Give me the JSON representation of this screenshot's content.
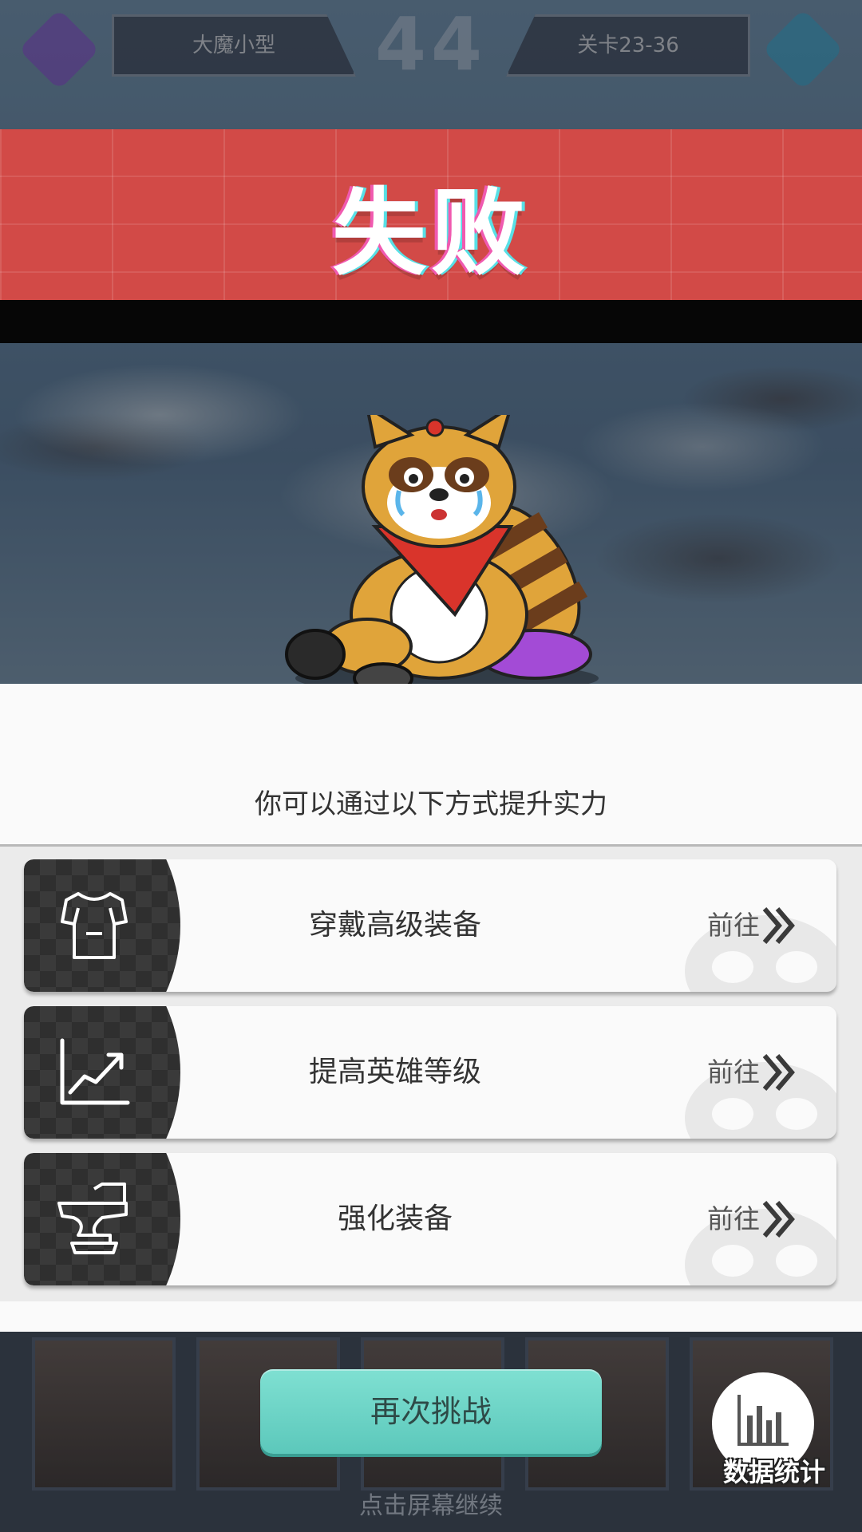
{
  "hud": {
    "left_team": "大魔小型",
    "score": "44",
    "right_team": "关卡23-36"
  },
  "result": {
    "title": "失败"
  },
  "advice": {
    "subtitle": "你可以通过以下方式提升实力",
    "items": [
      {
        "label": "穿戴高级装备",
        "action": "前往",
        "icon": "armor-icon"
      },
      {
        "label": "提高英雄等级",
        "action": "前往",
        "icon": "growth-chart-icon"
      },
      {
        "label": "强化装备",
        "action": "前往",
        "icon": "anvil-icon"
      }
    ]
  },
  "footer": {
    "retry_label": "再次挑战",
    "stats_label": "数据统计",
    "continue_hint": "点击屏幕继续"
  },
  "colors": {
    "banner": "#d24a47",
    "retry_button": "#6dd4c6",
    "icon_block": "#2f2f2f"
  }
}
